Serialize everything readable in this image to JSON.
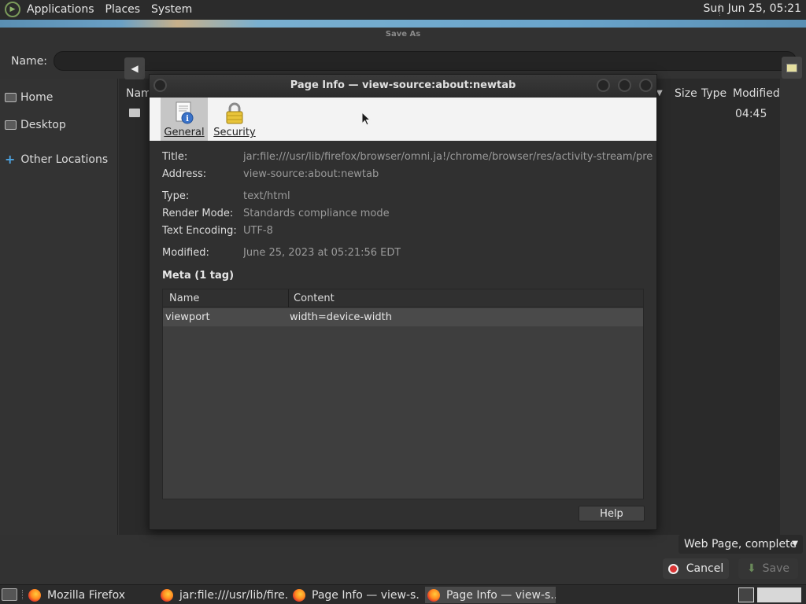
{
  "top_panel": {
    "menus": [
      "Applications",
      "Places",
      "System"
    ],
    "clock": "Sun Jun 25, 05:21"
  },
  "save_as": {
    "title": "Save As",
    "name_label": "Name:",
    "name_value": "",
    "places": [
      {
        "label": "Home",
        "icon": "folder-home-icon"
      },
      {
        "label": "Desktop",
        "icon": "folder-desktop-icon"
      },
      {
        "label": "Other Locations",
        "icon": "plus-icon"
      }
    ],
    "columns": {
      "name": "Nam",
      "size": "Size",
      "type": "Type",
      "modified": "Modified"
    },
    "row_modified": "04:45",
    "file_type": "Web Page, complete",
    "cancel_label": "Cancel",
    "save_label": "Save"
  },
  "page_info": {
    "title": "Page Info — view-source:about:newtab",
    "tabs": [
      {
        "label": "General",
        "icon": "page-info-icon",
        "selected": true
      },
      {
        "label": "Security",
        "icon": "padlock-icon",
        "selected": false
      }
    ],
    "fields": {
      "title_label": "Title:",
      "title_value": "jar:file:///usr/lib/firefox/browser/omni.ja!/chrome/browser/res/activity-stream/prerendered",
      "address_label": "Address:",
      "address_value": "view-source:about:newtab",
      "type_label": "Type:",
      "type_value": "text/html",
      "render_label": "Render Mode:",
      "render_value": "Standards compliance mode",
      "encoding_label": "Text Encoding:",
      "encoding_value": "UTF-8",
      "modified_label": "Modified:",
      "modified_value": "June 25, 2023 at 05:21:56 EDT"
    },
    "meta_heading": "Meta (1 tag)",
    "meta_columns": {
      "name": "Name",
      "content": "Content"
    },
    "meta_rows": [
      {
        "name": "viewport",
        "content": "width=device-width"
      }
    ],
    "help_label": "Help"
  },
  "taskbar": {
    "tasks": [
      {
        "label": "Mozilla Firefox",
        "active": false
      },
      {
        "label": "jar:file:///usr/lib/fire...",
        "active": false
      },
      {
        "label": "Page Info — view-s...",
        "active": false
      },
      {
        "label": "Page Info — view-s...",
        "active": true
      }
    ]
  }
}
